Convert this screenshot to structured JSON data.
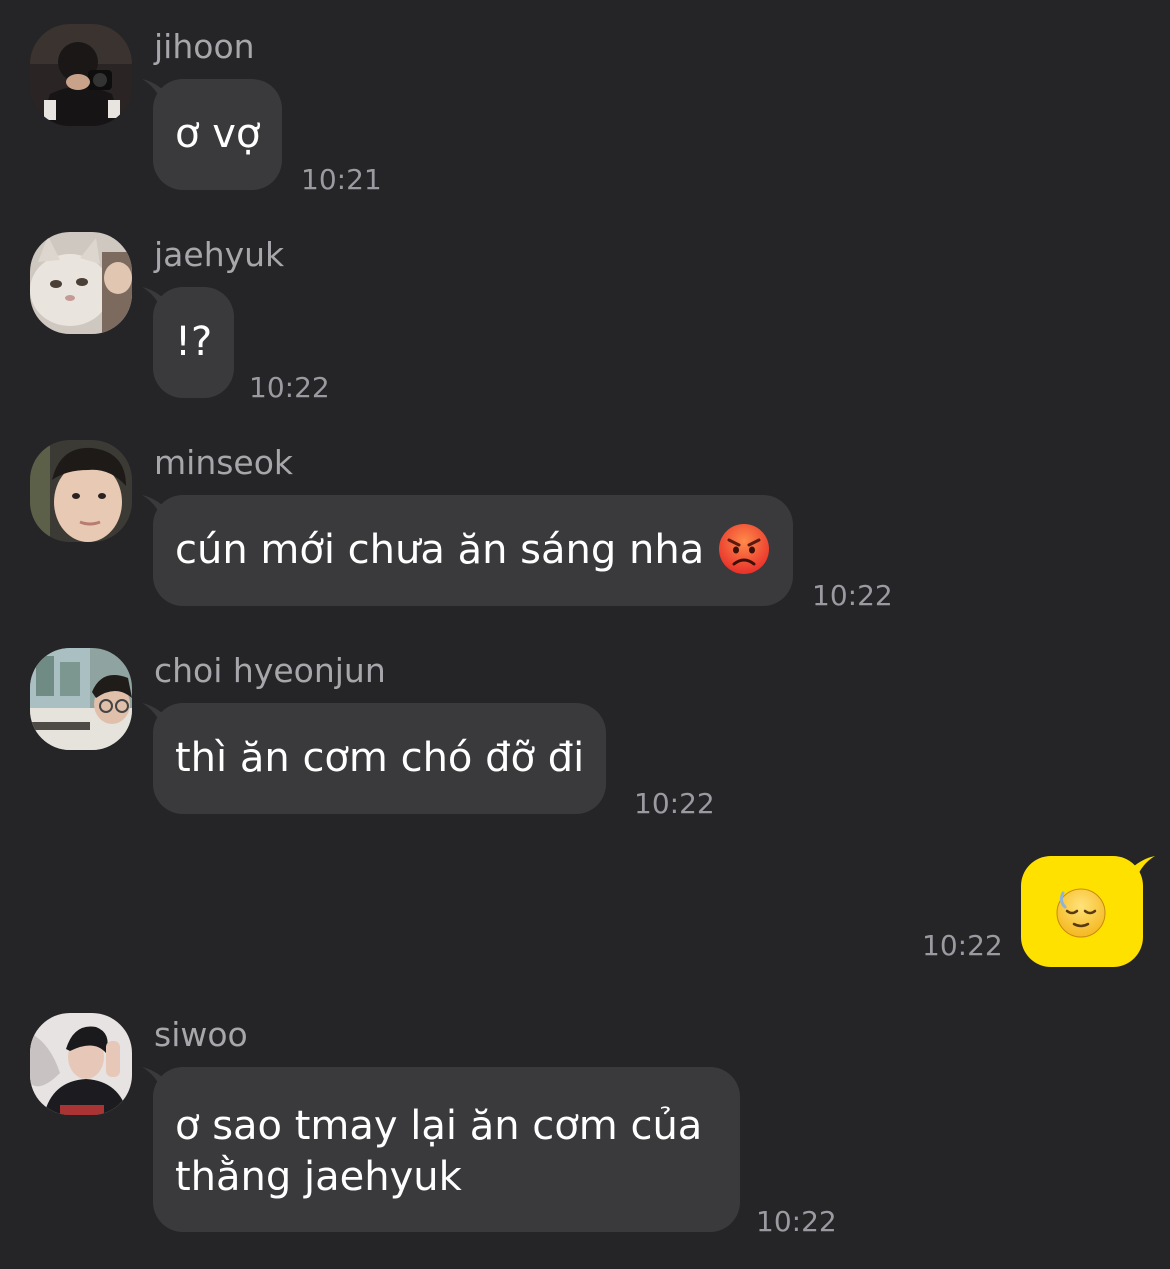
{
  "messages": [
    {
      "sender": "jihoon",
      "text": "ơ vợ",
      "time": "10:21",
      "avatar_icon": "avatar-jihoon-photo"
    },
    {
      "sender": "jaehyuk",
      "text": "!?",
      "time": "10:22",
      "avatar_icon": "avatar-jaehyuk-cat"
    },
    {
      "sender": "minseok",
      "text": "cún mới chưa ăn sáng nha",
      "emoji": "pouting-face-emoji",
      "time": "10:22",
      "avatar_icon": "avatar-minseok-photo"
    },
    {
      "sender": "choi hyeonjun",
      "text": "thì ăn cơm chó đỡ đi",
      "time": "10:22",
      "avatar_icon": "avatar-hyeonjun-photo"
    },
    {
      "sender": "siwoo",
      "text_line1": "ơ sao tmay lại ăn cơm của",
      "text_line2": "thằng jaehyuk",
      "time": "10:22",
      "avatar_icon": "avatar-siwoo-photo"
    }
  ],
  "my_message": {
    "emoji": "sweat-smile-pensive-emoji",
    "time": "10:22"
  },
  "colors": {
    "background": "#252527",
    "incoming_bubble": "#3a3a3d",
    "outgoing_bubble": "#ffe100",
    "sender_name": "#a6a6ab",
    "timestamp": "#9a9aa0"
  }
}
